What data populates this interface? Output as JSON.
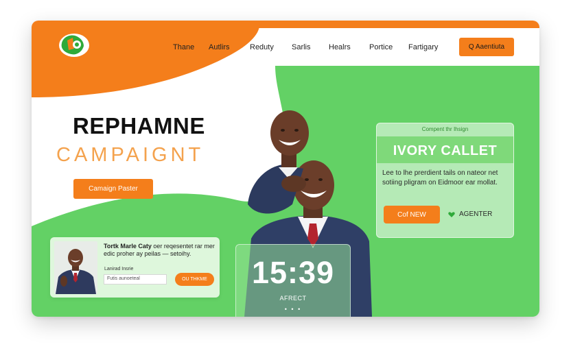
{
  "nav": {
    "items": [
      "Thane",
      "Autlirs",
      "Reduty",
      "Sarlis",
      "Healrs",
      "Portice",
      "Fartigary"
    ],
    "cta_label": "Q Aaentiuta"
  },
  "hero": {
    "title": "REPHAMNE",
    "subtitle": "CAMPAIGNT",
    "button_label": "Camaign Paster"
  },
  "right_card": {
    "kicker": "Compent thr Ihsign",
    "title": "IVORY CALLET",
    "body": "Lee to lhe prerdient tails on nateor net sotiing pligram on Eidmoor ear mollat.",
    "button_label": "Cof NEW",
    "link_label": "AGENTER"
  },
  "subscribe_card": {
    "text_bold": "Tortk Marle Caty",
    "text_rest": " oer reqesentet rar mer edic proher ay peilas — setoihy.",
    "field_label": "Lanirad Insrie",
    "field_placeholder": "Futis aunoeteal",
    "button_label": "OU THKME"
  },
  "clock": {
    "time": "15:39",
    "label": "AFRECT",
    "dots": "• • •"
  },
  "colors": {
    "orange": "#f47e1b",
    "green": "#63d165",
    "white": "#ffffff"
  }
}
